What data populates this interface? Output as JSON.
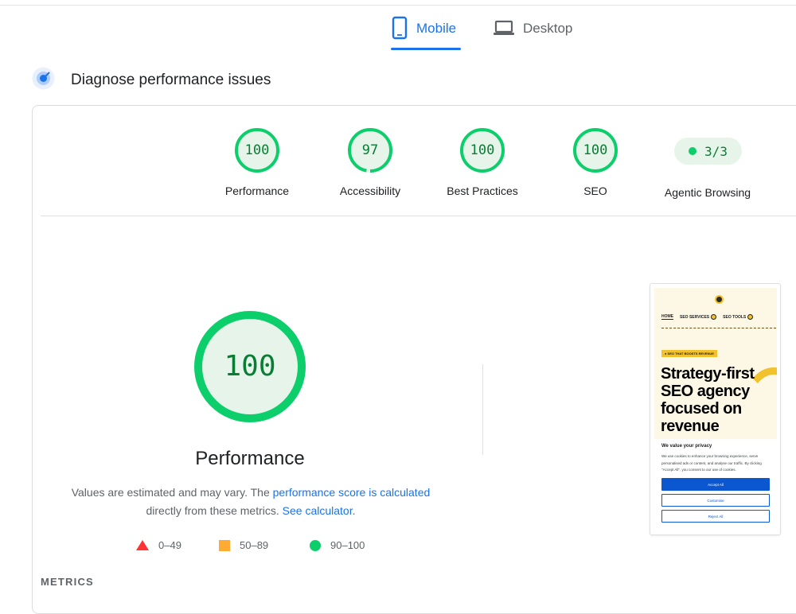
{
  "tabs": [
    {
      "label": "Mobile",
      "icon": "smartphone-icon",
      "active": true
    },
    {
      "label": "Desktop",
      "icon": "laptop-icon",
      "active": false
    }
  ],
  "diagnose": {
    "title": "Diagnose performance issues",
    "icon": "diagnose-icon"
  },
  "categories": [
    {
      "label": "Performance",
      "score": "100",
      "fraction": 1.0
    },
    {
      "label": "Accessibility",
      "score": "97",
      "fraction": 0.97
    },
    {
      "label": "Best Practices",
      "score": "100",
      "fraction": 1.0
    },
    {
      "label": "SEO",
      "score": "100",
      "fraction": 1.0
    }
  ],
  "agentic": {
    "label": "Agentic Browsing",
    "score": "3/3"
  },
  "performance": {
    "score": "100",
    "title": "Performance",
    "explain_prefix": "Values are estimated and may vary. The ",
    "explain_link": "performance score is calculated",
    "explain_mid": " directly from these metrics. ",
    "explain_calc": "See calculator",
    "explain_suffix": "."
  },
  "legend": [
    {
      "range": "0–49",
      "shape": "triangle",
      "color": "#ff3333"
    },
    {
      "range": "50–89",
      "shape": "square",
      "color": "#ffaa33"
    },
    {
      "range": "90–100",
      "shape": "circle",
      "color": "#0cce6b"
    }
  ],
  "metrics_heading": "METRICS",
  "colors": {
    "accent": "#1a73e8",
    "pass": "#0cce6b",
    "pass_text": "#0a7d34",
    "pass_bg": "#e6f4ea"
  },
  "screenshot": {
    "nav": [
      "HOME",
      "SEO SERVICES",
      "SEO TOOLS"
    ],
    "badge": "● SEO THAT BOOSTS REVENUE",
    "headline": "Strategy-first SEO agency focused on revenue",
    "privacy_title": "We value your privacy",
    "privacy_body": "We use cookies to enhance your browsing experience, serve personalised ads or content, and analyse our traffic. By clicking \"Accept All\", you consent to our use of cookies.",
    "accept": "Accept All",
    "customise": "Customise",
    "reject": "Reject All"
  }
}
